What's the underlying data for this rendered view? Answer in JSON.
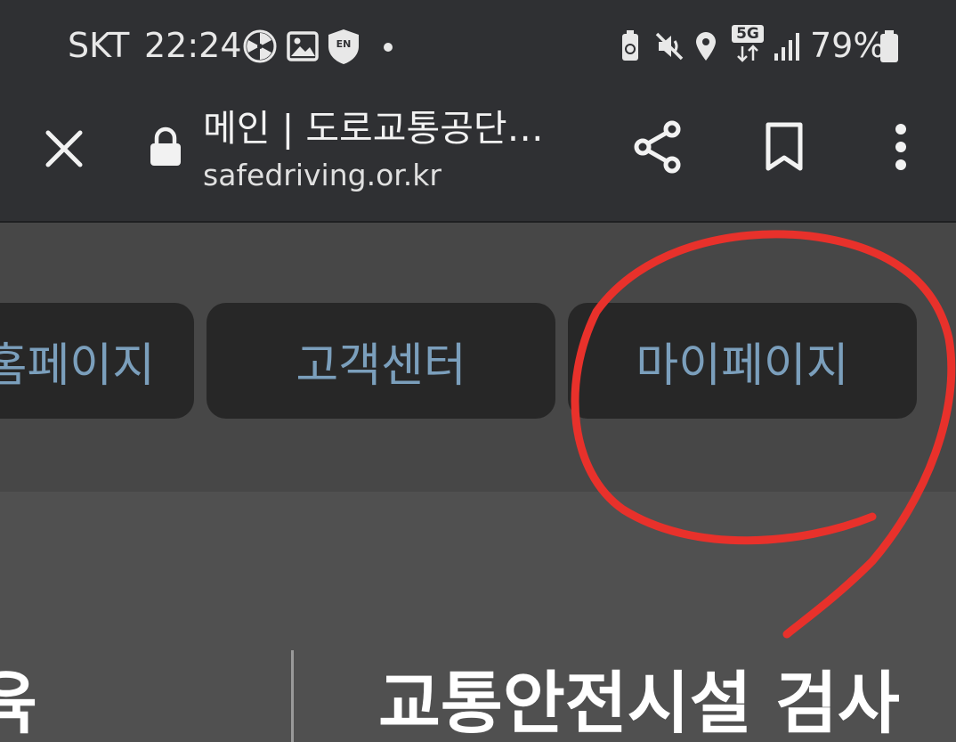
{
  "status_bar": {
    "carrier": "SKT",
    "time": "22:24",
    "battery_percent": "79%",
    "network_label": "5G",
    "left_icons": [
      "fan-icon",
      "gallery-icon",
      "en-shield-icon",
      "notification-dot-icon"
    ],
    "right_icons": [
      "battery-saver-icon",
      "mute-icon",
      "location-icon",
      "5g-data-icon",
      "signal-bars-icon",
      "battery-icon"
    ]
  },
  "browser": {
    "page_title": "메인 | 도로교통공단…",
    "url": "safedriving.or.kr",
    "icons": [
      "close-icon",
      "lock-icon",
      "share-icon",
      "bookmark-icon",
      "more-vert-icon"
    ]
  },
  "nav": {
    "items": [
      {
        "label": "홈페이지"
      },
      {
        "label": "고객센터"
      },
      {
        "label": "마이페이지"
      }
    ]
  },
  "sections": {
    "left_heading": "육",
    "right_heading": "교통안전시설 검사"
  },
  "colors": {
    "toolbar_bg": "#2f3033",
    "nav_band_bg": "#474747",
    "nav_button_bg": "#272727",
    "nav_button_text": "#7b9fbc",
    "annotation_red": "#e8312b"
  }
}
